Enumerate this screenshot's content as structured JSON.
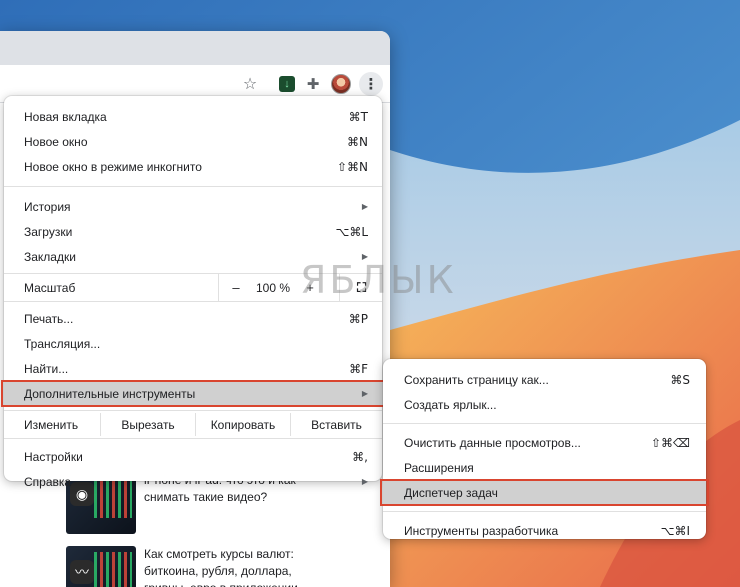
{
  "watermark": "ЯБЛЫК",
  "toolbar": {
    "icons": [
      "star-icon",
      "extension-download-icon",
      "puzzle-icon",
      "avatar",
      "kebab-menu-icon"
    ]
  },
  "articles": [
    {
      "text": "iPhone и iPad: что это и как снимать такие видео?"
    },
    {
      "text": "Как смотреть курсы валют: биткоина, рубля, доллара, гривны, евро в приложении Акции на iPhone"
    }
  ],
  "menu": {
    "new_tab": {
      "label": "Новая вкладка",
      "shortcut": "⌘T"
    },
    "new_window": {
      "label": "Новое окно",
      "shortcut": "⌘N"
    },
    "new_incognito": {
      "label": "Новое окно в режиме инкогнито",
      "shortcut": "⇧⌘N"
    },
    "history": {
      "label": "История"
    },
    "downloads": {
      "label": "Загрузки",
      "shortcut": "⌥⌘L"
    },
    "bookmarks": {
      "label": "Закладки"
    },
    "zoom": {
      "label": "Масштаб",
      "minus": "–",
      "value": "100 %",
      "plus": "+",
      "fullscreen": "⛶"
    },
    "print": {
      "label": "Печать...",
      "shortcut": "⌘P"
    },
    "cast": {
      "label": "Трансляция..."
    },
    "find": {
      "label": "Найти...",
      "shortcut": "⌘F"
    },
    "more_tools": {
      "label": "Дополнительные инструменты"
    },
    "edit": {
      "label": "Изменить",
      "cut": "Вырезать",
      "copy": "Копировать",
      "paste": "Вставить"
    },
    "settings": {
      "label": "Настройки",
      "shortcut": "⌘,"
    },
    "help": {
      "label": "Справка"
    }
  },
  "submenu": {
    "save_page": {
      "label": "Сохранить страницу как...",
      "shortcut": "⌘S"
    },
    "create_shortcut": {
      "label": "Создать ярлык..."
    },
    "clear_data": {
      "label": "Очистить данные просмотров...",
      "shortcut": "⇧⌘⌫"
    },
    "extensions": {
      "label": "Расширения"
    },
    "task_manager": {
      "label": "Диспетчер задач"
    },
    "dev_tools": {
      "label": "Инструменты разработчика",
      "shortcut": "⌥⌘I"
    }
  },
  "colors": {
    "highlight_border": "#d9452f",
    "highlight_bg": "#d0d0d0",
    "wallpaper_blue": "#3d7fc4",
    "wallpaper_orange": "#f0a64a"
  }
}
